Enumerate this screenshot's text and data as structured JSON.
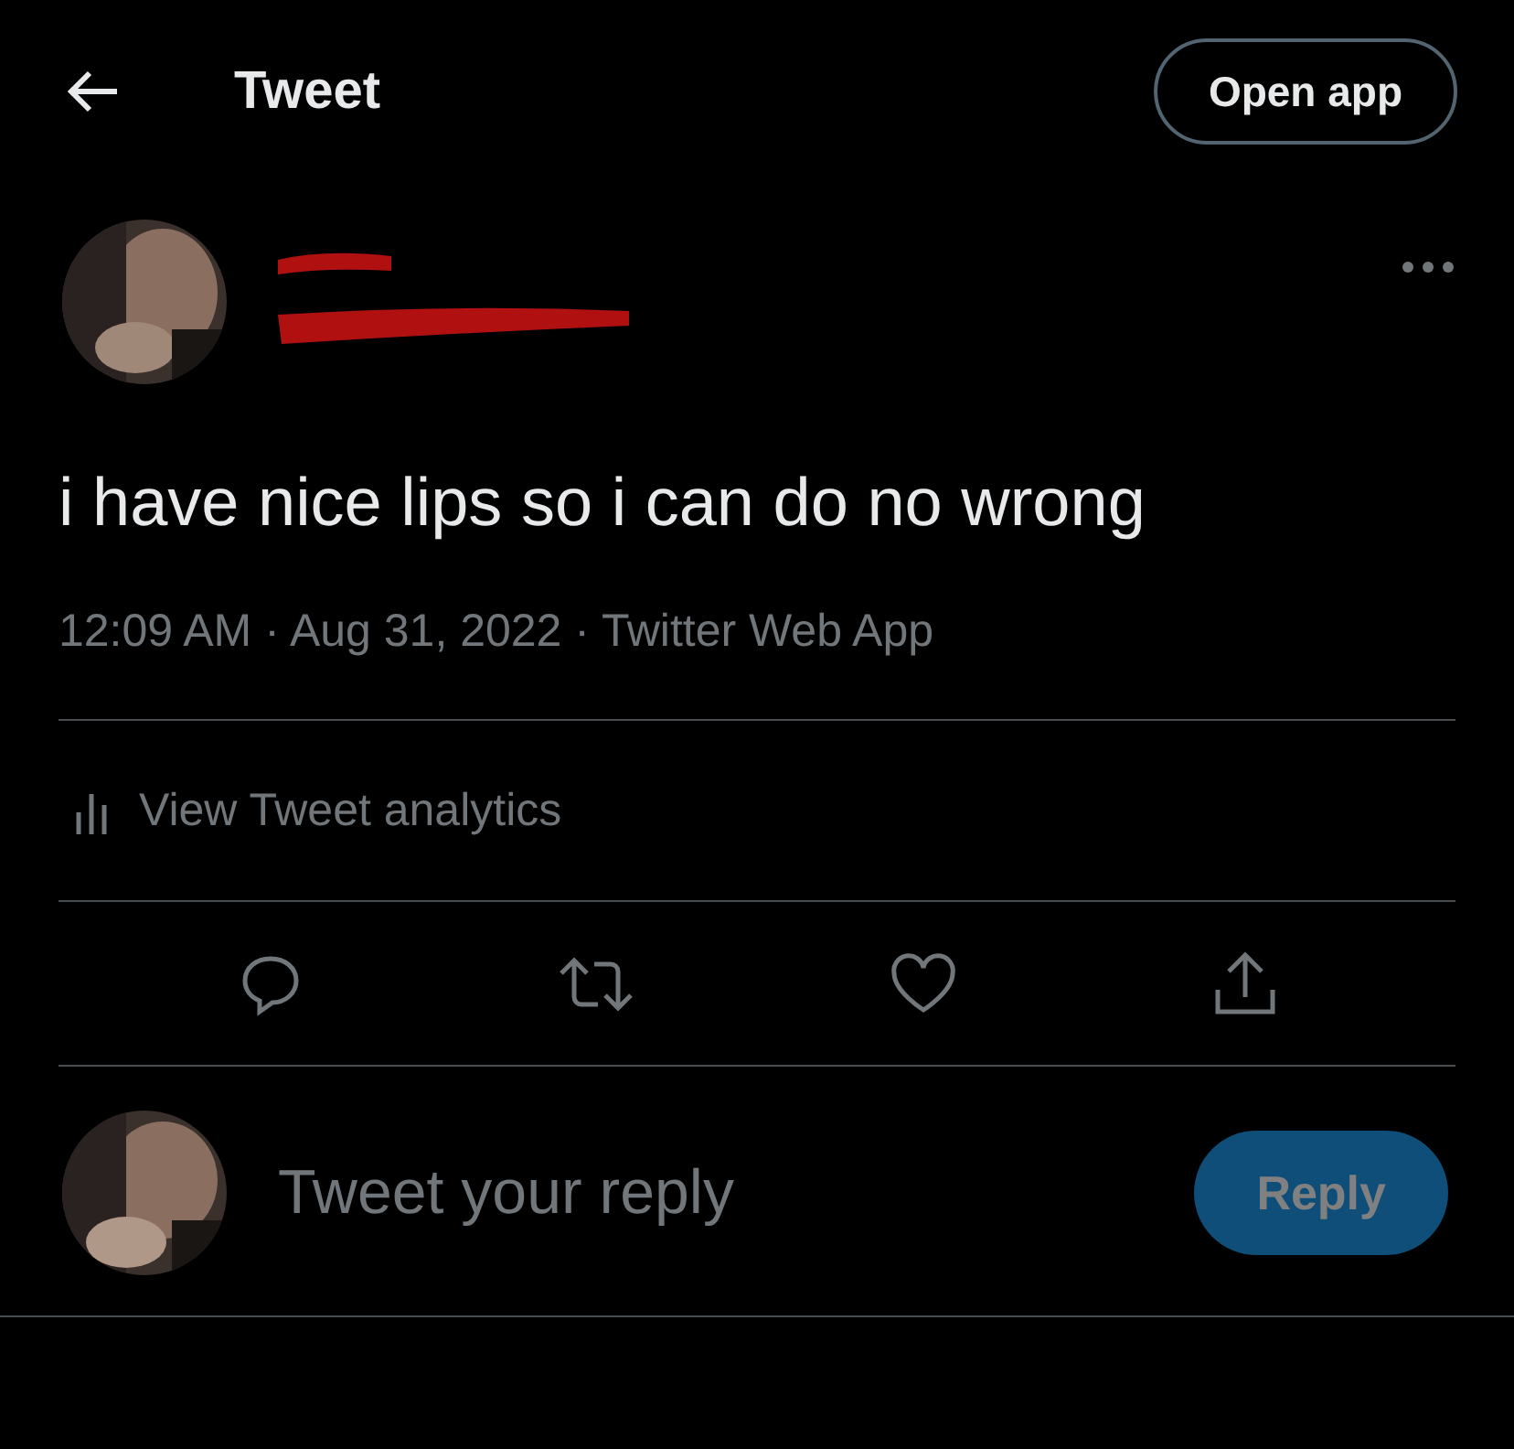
{
  "header": {
    "title": "Tweet",
    "open_app": "Open app"
  },
  "tweet": {
    "text": "i have nice lips so i can do no wrong",
    "meta": "12:09 AM · Aug 31, 2022 · Twitter Web App",
    "analytics": "View Tweet analytics"
  },
  "reply": {
    "placeholder": "Tweet your reply",
    "button": "Reply",
    "disabled": true
  }
}
